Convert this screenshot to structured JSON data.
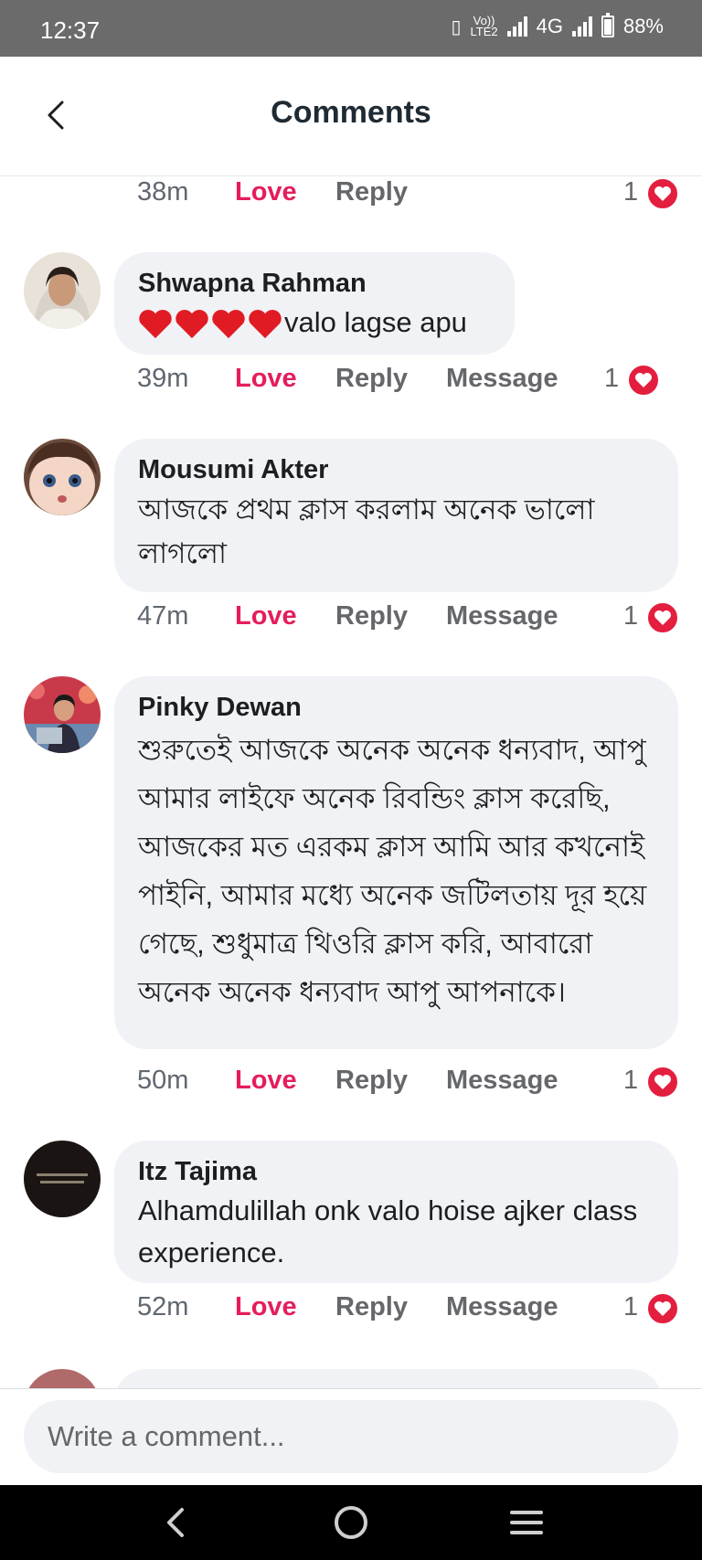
{
  "status_bar": {
    "time": "12:37",
    "network_top": "Vo))",
    "network_bottom": "LTE2",
    "network_type": "4G",
    "battery": "88%"
  },
  "header": {
    "title": "Comments"
  },
  "comments": [
    {
      "time": "38m",
      "love": "Love",
      "reply": "Reply",
      "reaction_count": "1"
    },
    {
      "author": "Shwapna Rahman",
      "text": "valo lagse apu",
      "emoji_hearts": 4,
      "time": "39m",
      "love": "Love",
      "reply": "Reply",
      "message": "Message",
      "reaction_count": "1"
    },
    {
      "author": "Mousumi Akter",
      "text": "আজকে প্রথম ক্লাস করলাম অনেক ভালো লাগলো",
      "time": "47m",
      "love": "Love",
      "reply": "Reply",
      "message": "Message",
      "reaction_count": "1"
    },
    {
      "author": "Pinky Dewan",
      "text": "শুরুতেই আজকে অনেক অনেক ধন্যবাদ, আপু আমার লাইফে অনেক রিবন্ডিং ক্লাস করেছি, আজকের মত এরকম ক্লাস আমি আর কখনোই পাইনি, আমার মধ্যে অনেক জটিলতায় দূর হয়ে গেছে, শুধুমাত্র থিওরি ক্লাস করি, আবারো অনেক অনেক ধন্যবাদ আপু আপনাকে।",
      "time": "50m",
      "love": "Love",
      "reply": "Reply",
      "message": "Message",
      "reaction_count": "1"
    },
    {
      "author": "Itz Tajima",
      "text": "Alhamdulillah onk valo hoise ajker class experience.",
      "time": "52m",
      "love": "Love",
      "reply": "Reply",
      "message": "Message",
      "reaction_count": "1"
    }
  ],
  "composer": {
    "placeholder": "Write a comment..."
  },
  "colors": {
    "love": "#e41e5b",
    "bubble": "#f0f2f5",
    "heart": "#e41e3f",
    "statusbar": "#6b6b6b"
  }
}
